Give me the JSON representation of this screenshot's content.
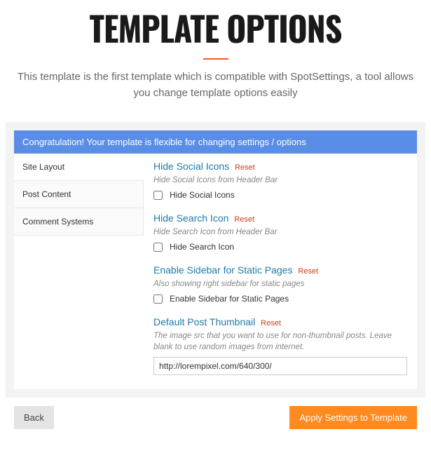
{
  "page": {
    "title": "TEMPLATE OPTIONS",
    "subtitle": "This template is the first template which is compatible with SpotSettings,\na tool allows you change template options easily"
  },
  "panel": {
    "header": "Congratulation! Your template is flexible for changing settings / options"
  },
  "sidebar": {
    "items": [
      {
        "label": "Site Layout"
      },
      {
        "label": "Post Content"
      },
      {
        "label": "Comment Systems"
      }
    ]
  },
  "options": {
    "reset_label": "Reset",
    "hide_social": {
      "title": "Hide Social Icons",
      "desc": "Hide Social Icons from Header Bar",
      "checkbox_label": "Hide Social Icons"
    },
    "hide_search": {
      "title": "Hide Search Icon",
      "desc": "Hide Search Icon from Header Bar",
      "checkbox_label": "Hide Search Icon"
    },
    "sidebar_static": {
      "title": "Enable Sidebar for Static Pages",
      "desc": "Also showing right sidebar for static pages",
      "checkbox_label": "Enable Sidebar for Static Pages"
    },
    "thumbnail": {
      "title": "Default Post Thumbnail",
      "desc": "The image src that you want to use for non-thumbnail posts. Leave blank to use random images from internet.",
      "value": "http://lorempixel.com/640/300/"
    }
  },
  "footer": {
    "back": "Back",
    "apply": "Apply Settings to Template"
  }
}
